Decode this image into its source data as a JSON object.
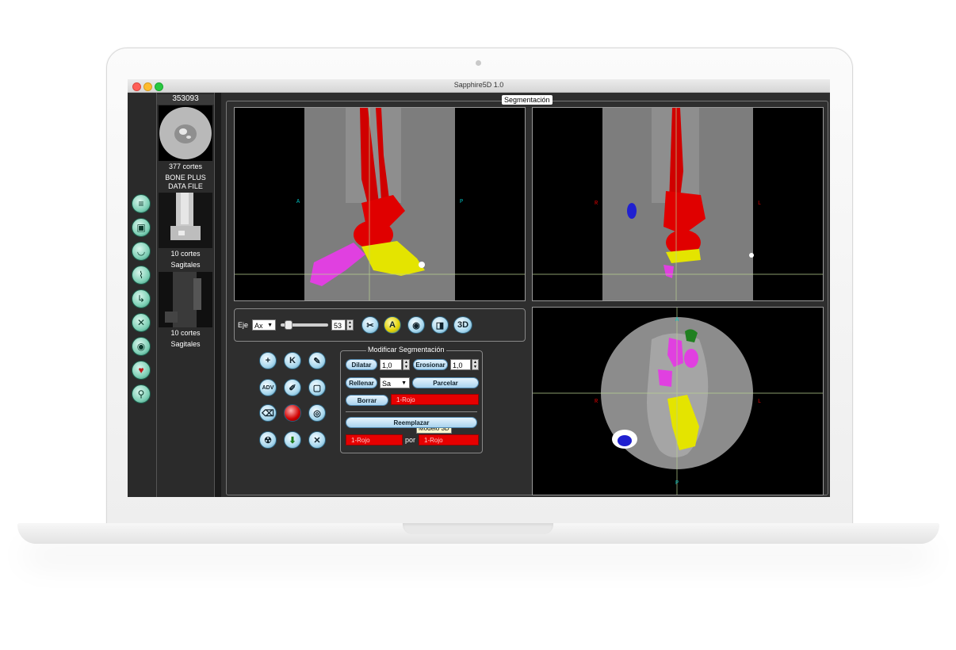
{
  "window": {
    "title": "Sapphire5D 1.0"
  },
  "series": [
    {
      "id": "353093",
      "count": "377 cortes",
      "desc_line1": "BONE PLUS",
      "desc_line2": "DATA FILE"
    },
    {
      "count": "10 cortes",
      "desc": "Sagitales"
    },
    {
      "count": "10 cortes",
      "desc": "Sagitales"
    }
  ],
  "tools": {
    "left_strip_icons": [
      "stack-icon",
      "cube-icon",
      "jaw-icon",
      "probe-icon",
      "foot-icon",
      "bone-icon",
      "cylinder-icon",
      "heart-icon",
      "microscope-icon"
    ]
  },
  "segmentation": {
    "title": "Segmentación",
    "viewports": {
      "sagittal": {
        "left_label": "A",
        "right_label": "P"
      },
      "coronal": {
        "left_label": "R",
        "right_label": "L"
      },
      "axial": {
        "top_label": "A",
        "bottom_label": "P",
        "left_label": "R",
        "right_label": "L"
      }
    },
    "axis": {
      "label": "Eje",
      "value": "Ax",
      "slice_value": "53",
      "slider_fraction": 0.1
    },
    "view_buttons": {
      "three_d": "3D"
    },
    "tool_grid": {
      "adv_label": "ADV",
      "k_label": "K",
      "tooltip": "Modelo 3D"
    },
    "modify": {
      "title": "Modificar Segmentación",
      "dilate_label": "Dilatar",
      "dilate_value": "1,0",
      "erode_label": "Erosionar",
      "erode_value": "1,0",
      "fill_label": "Rellenar",
      "fill_value": "Sa",
      "parcel_label": "Parcelar",
      "erase_label": "Borrar",
      "erase_target": "1-Rojo",
      "replace_label": "Reemplazar",
      "replace_from": "1-Rojo",
      "replace_by": "por",
      "replace_to": "1-Rojo"
    }
  },
  "colors": {
    "segment_red": "#e60000",
    "segment_magenta": "#e040e0",
    "segment_yellow": "#e4e400",
    "segment_blue": "#2020d0",
    "segment_green": "#208020",
    "crosshair": "#b8d090"
  }
}
